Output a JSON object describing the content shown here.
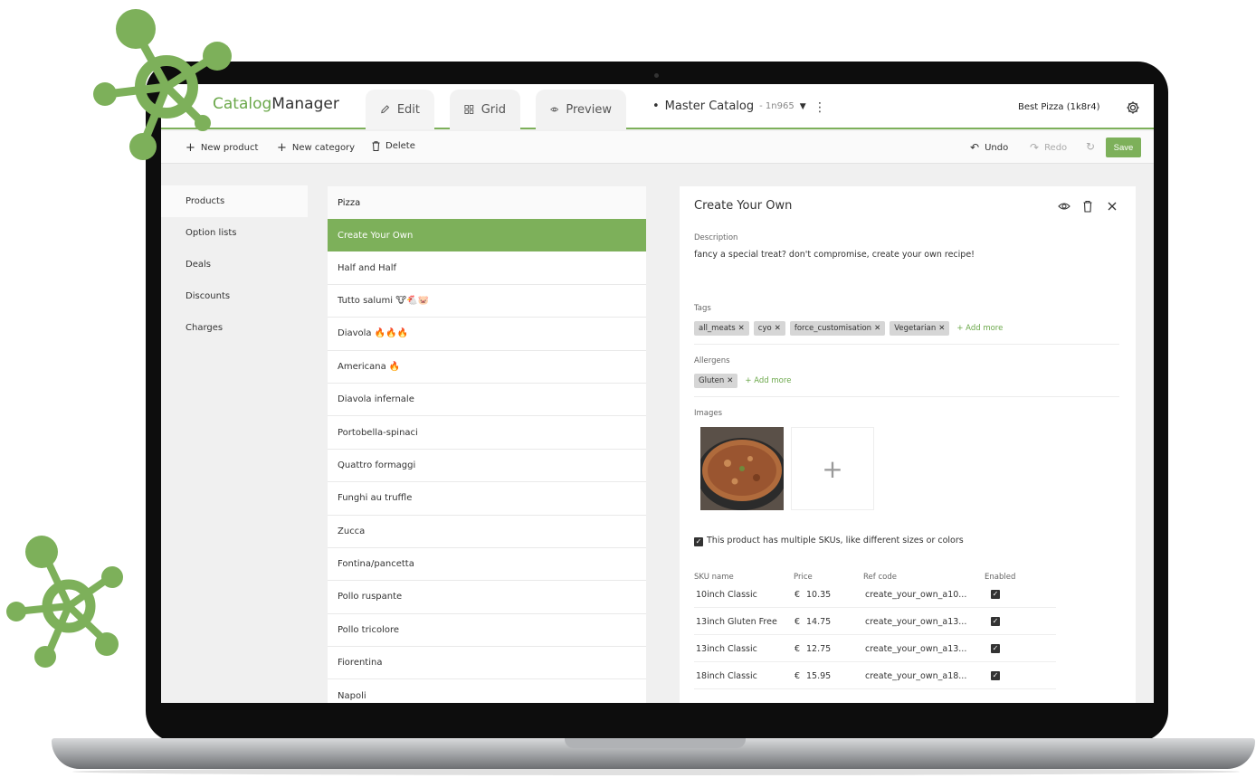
{
  "header": {
    "logo_prefix": "Catalog",
    "logo_suffix": "Manager",
    "tabs": [
      {
        "label": "Edit",
        "icon": "pencil-icon"
      },
      {
        "label": "Grid",
        "icon": "grid-icon"
      },
      {
        "label": "Preview",
        "icon": "eye-icon"
      }
    ],
    "catalog_name": "Master Catalog",
    "catalog_id": "- 1n965",
    "store_name": "Best Pizza (1k8r4)"
  },
  "toolbar": {
    "new_product": "New product",
    "new_category": "New category",
    "delete": "Delete",
    "undo": "Undo",
    "redo": "Redo",
    "save": "Save"
  },
  "sidebar": {
    "items": [
      "Products",
      "Option lists",
      "Deals",
      "Discounts",
      "Charges"
    ]
  },
  "category": {
    "name": "Pizza",
    "products": [
      "Create Your Own",
      "Half and Half",
      "Tutto salumi 🐮🐔🐷",
      "Diavola 🔥🔥🔥",
      "Americana 🔥",
      "Diavola infernale",
      "Portobella-spinaci",
      "Quattro formaggi",
      "Funghi au truffle",
      "Zucca",
      "Fontina/pancetta",
      "Pollo ruspante",
      "Pollo tricolore",
      "Fiorentina",
      "Napoli"
    ]
  },
  "detail": {
    "title": "Create Your Own",
    "description_label": "Description",
    "description": "fancy a special treat? don't compromise, create your own recipe!",
    "tags_label": "Tags",
    "tags": [
      "all_meats",
      "cyo",
      "force_customisation",
      "Vegetarian"
    ],
    "add_more": "+ Add more",
    "allergens_label": "Allergens",
    "allergens": [
      "Gluten"
    ],
    "images_label": "Images",
    "multi_sku_label": "This product has multiple SKUs, like different sizes or colors",
    "sku_headers": [
      "SKU name",
      "Price",
      "Ref code",
      "Enabled"
    ],
    "skus": [
      {
        "name": "10inch Classic",
        "currency": "€",
        "price": "10.35",
        "ref": "create_your_own_a10...",
        "enabled": true
      },
      {
        "name": "13inch Gluten Free",
        "currency": "€",
        "price": "14.75",
        "ref": "create_your_own_a13...",
        "enabled": true
      },
      {
        "name": "13inch Classic",
        "currency": "€",
        "price": "12.75",
        "ref": "create_your_own_a13...",
        "enabled": true
      },
      {
        "name": "18inch Classic",
        "currency": "€",
        "price": "15.95",
        "ref": "create_your_own_a18...",
        "enabled": true
      }
    ]
  },
  "colors": {
    "accent": "#7db05a",
    "deco": "#7db05a"
  }
}
